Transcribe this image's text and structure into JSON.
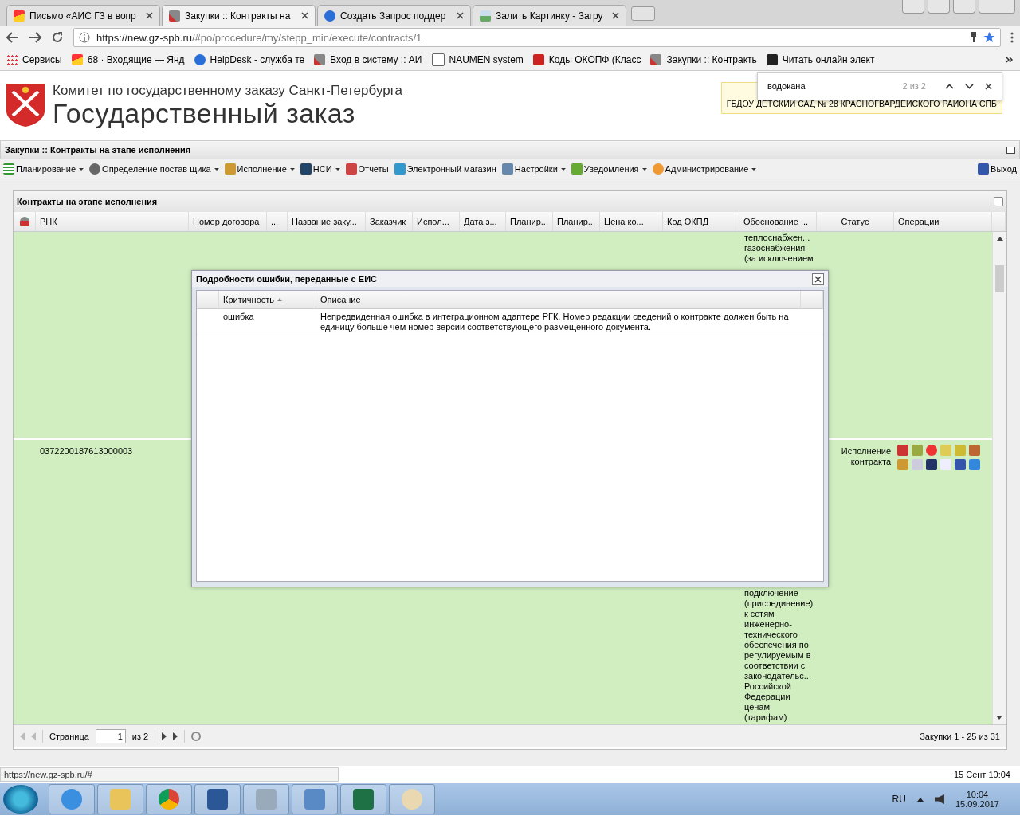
{
  "browser": {
    "tabs": [
      {
        "title": "Письмо «АИС ГЗ в вопр",
        "selected": false
      },
      {
        "title": "Закупки :: Контракты на",
        "selected": true
      },
      {
        "title": "Создать Запрос поддер",
        "selected": false
      },
      {
        "title": "Залить Картинку - Загру",
        "selected": false
      }
    ],
    "url_host": "https://new.gz-spb.ru",
    "url_path": "/#po/procedure/my/stepp_min/execute/contracts/1",
    "bookmarks": [
      {
        "label": "Сервисы"
      },
      {
        "label": "68 · Входящие — Янд"
      },
      {
        "label": "HelpDesk - служба те"
      },
      {
        "label": "Вход в систему :: АИ"
      },
      {
        "label": "NAUMEN system"
      },
      {
        "label": "Коды ОКОПФ (Класс"
      },
      {
        "label": "Закупки :: Контракть"
      },
      {
        "label": "Читать онлайн элект"
      }
    ],
    "find_bar": {
      "query": "водокана",
      "count": "2 из 2"
    },
    "status_url": "https://new.gz-spb.ru/#"
  },
  "header": {
    "org": "Комитет по государственному заказу Санкт-Петербурга",
    "title": "Государственный заказ",
    "user_org": "ГБДОУ ДЕТСКИЙ САД № 28 КРАСНОГВАРДЕЙСКОГО РАЙОНА СПБ"
  },
  "panel_title": "Закупки :: Контракты на этапе исполнения",
  "menu": [
    {
      "label": "Планирование",
      "dropdown": true
    },
    {
      "label": "Определение постав щика",
      "dropdown": true
    },
    {
      "label": "Исполнение",
      "dropdown": true
    },
    {
      "label": "НСИ",
      "dropdown": true
    },
    {
      "label": "Отчеты",
      "dropdown": false
    },
    {
      "label": "Электронный магазин",
      "dropdown": false
    },
    {
      "label": "Настройки",
      "dropdown": true
    },
    {
      "label": "Уведомления",
      "dropdown": true
    },
    {
      "label": "Администрирование",
      "dropdown": true
    }
  ],
  "exit": "Выход",
  "grid": {
    "title": "Контракты на этапе исполнения",
    "columns": [
      "РНК",
      "Номер договора",
      "...",
      "Название заку...",
      "Заказчик",
      "Испол...",
      "Дата з...",
      "Планир...",
      "Планир...",
      "Цена ко...",
      "Код ОКПД",
      "Обоснование ...",
      "Статус",
      "Операции"
    ],
    "rows": [
      {
        "rnk": "",
        "reason": [
          "теплоснабжен...",
          "газоснабжения",
          "(за исключением"
        ],
        "status": ""
      },
      {
        "rnk": "0372200187613000003",
        "reason": [
          "подключение",
          "(присоединение)",
          "к сетям",
          "инженерно-",
          "технического",
          "обеспечения по",
          "регулируемым в",
          "соответствии с",
          "законодательс...",
          "Российской",
          "Федерации",
          "ценам",
          "(тарифам)"
        ],
        "status": "Исполнение контракта"
      }
    ]
  },
  "pager": {
    "page_label": "Страница",
    "page": "1",
    "of": "из 2",
    "summary": "Закупки 1 - 25 из 31"
  },
  "dialog": {
    "title": "Подробности ошибки, переданные с ЕИС",
    "columns": [
      {
        "label": "Критичность",
        "sorted": true
      },
      {
        "label": "Описание",
        "sorted": false
      }
    ],
    "rows": [
      {
        "severity": "ошибка",
        "description": "Непредвиденная ошибка в интеграционном адаптере РГК. Номер редакции сведений о контракте должен быть на единицу больше чем номер версии соответствующего размещённого документа."
      }
    ]
  },
  "server_time": "15 Сент 10:04",
  "taskbar": {
    "lang": "RU",
    "time": "10:04",
    "date": "15.09.2017"
  }
}
